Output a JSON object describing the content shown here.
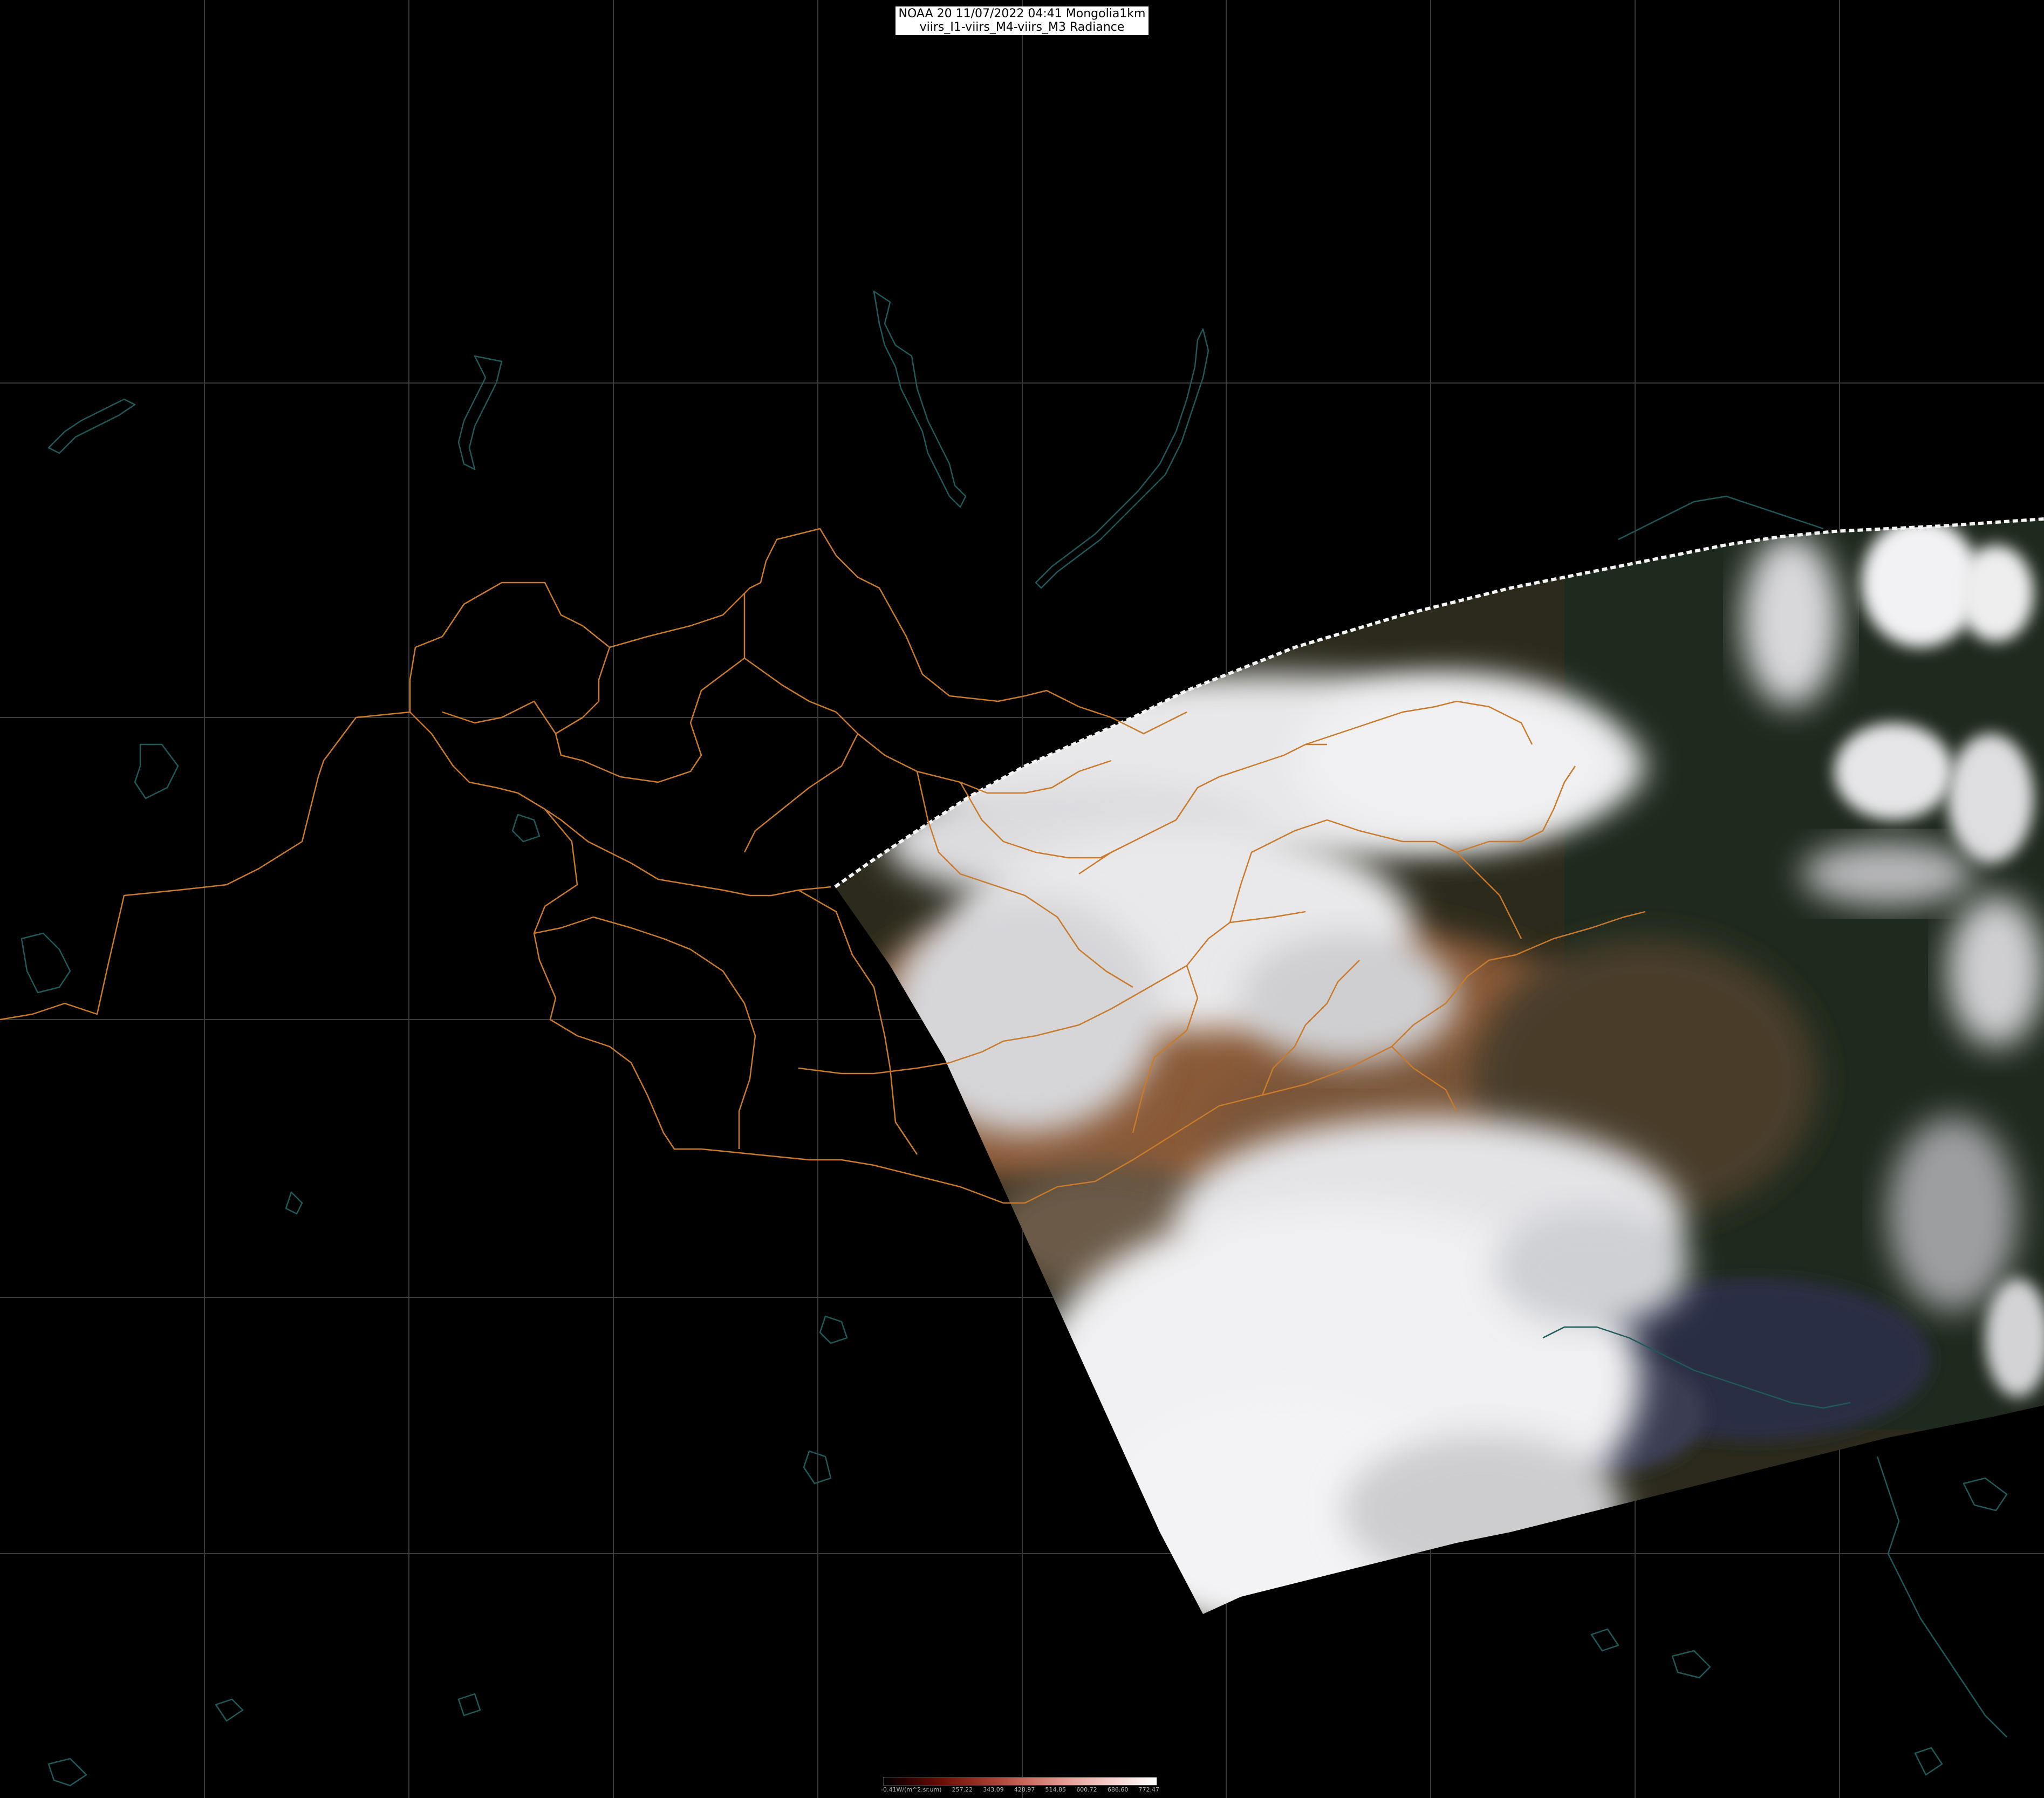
{
  "title": {
    "line1": "NOAA 20 11/07/2022 04:41 Mongolia1km",
    "line2": "viirs_I1-viirs_M4-viirs_M3 Radiance"
  },
  "colorbar": {
    "ticks": [
      "-0.41W/(m^2.sr.um)",
      "257.22",
      "343.09",
      "428.97",
      "514.85",
      "600.72",
      "686.60",
      "772.47"
    ]
  },
  "colors": {
    "background": "#000000",
    "graticule": "#3a3a3a",
    "borders": "#c97a2a",
    "coastlines": "#1f5a5a"
  }
}
